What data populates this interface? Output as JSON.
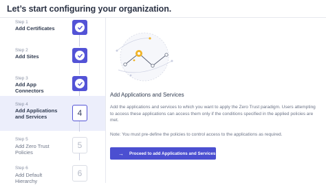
{
  "header": {
    "title": "Let’s start configuring your organization."
  },
  "steps": [
    {
      "number": "Step 1",
      "label": "Add Certificates",
      "state": "done"
    },
    {
      "number": "Step 2",
      "label": "Add Sites",
      "state": "done"
    },
    {
      "number": "Step 3",
      "label": "Add App Connectors",
      "state": "done"
    },
    {
      "number": "Step 4",
      "label": "Add Applications and Services",
      "state": "current",
      "badge": "4"
    },
    {
      "number": "Step 5",
      "label": "Add Zero Trust Policies",
      "state": "todo",
      "badge": "5"
    },
    {
      "number": "Step 6",
      "label": "Add Default Hierarchy",
      "state": "todo",
      "badge": "6"
    }
  ],
  "icons": {
    "done_badge": "check-icon",
    "illustration": "network-apps-illustration",
    "cta": "arrow-right-icon"
  },
  "colors": {
    "accent": "#5353d6",
    "active_row_bg": "#eceefb",
    "illustration_accent": "#f0b429"
  },
  "content": {
    "title": "Add Applications and Services",
    "body": "Add the applications and services to which you want to apply the Zero Trust paradigm. Users attempting to access these applications can access them only if the conditions specified in the applied policies are met.",
    "note": "Note: You must pre-define the policies to control access to the applications as required.",
    "cta_label": "Proceed to add Applications and Services"
  }
}
